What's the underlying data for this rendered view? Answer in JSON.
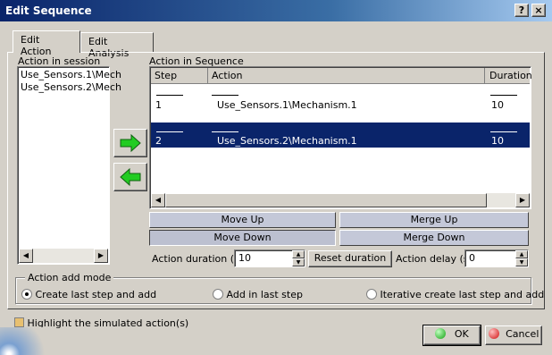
{
  "window": {
    "title": "Edit Sequence",
    "help_btn": "?",
    "close_btn": "×"
  },
  "tabs": [
    {
      "label": "Edit Action"
    },
    {
      "label": "Edit Analysis"
    }
  ],
  "session": {
    "label": "Action in session",
    "items": [
      "Use_Sensors.1\\Mech",
      "Use_Sensors.2\\Mech"
    ]
  },
  "sequence": {
    "label": "Action in Sequence",
    "columns": {
      "step": "Step",
      "action": "Action",
      "duration": "Duration"
    },
    "rows": [
      {
        "step": "1",
        "action": "Use_Sensors.1\\Mechanism.1",
        "duration": "10"
      },
      {
        "step": "2",
        "action": "Use_Sensors.2\\Mechanism.1",
        "duration": "10"
      }
    ],
    "selected_step": "2"
  },
  "buttons": {
    "move_up": "Move Up",
    "move_down": "Move Down",
    "merge_up": "Merge Up",
    "merge_down": "Merge Down",
    "reset_duration": "Reset duration",
    "ok": "OK",
    "cancel": "Cancel"
  },
  "fields": {
    "action_duration_label": "Action duration (s)",
    "action_duration_value": "10",
    "action_delay_label": "Action delay (s)",
    "action_delay_value": "0"
  },
  "add_mode": {
    "title": "Action add mode",
    "options": [
      {
        "label": "Create last step and add",
        "selected": true
      },
      {
        "label": "Add in last step",
        "selected": false
      },
      {
        "label": "Iterative create last step and add",
        "selected": false
      }
    ]
  },
  "highlight": {
    "label": "Highlight the simulated action(s)",
    "checked": false
  },
  "colors": {
    "selection": "#0a246a",
    "arrow": "#22cc22",
    "title_start": "#0a246a",
    "title_end": "#a6caf0"
  }
}
